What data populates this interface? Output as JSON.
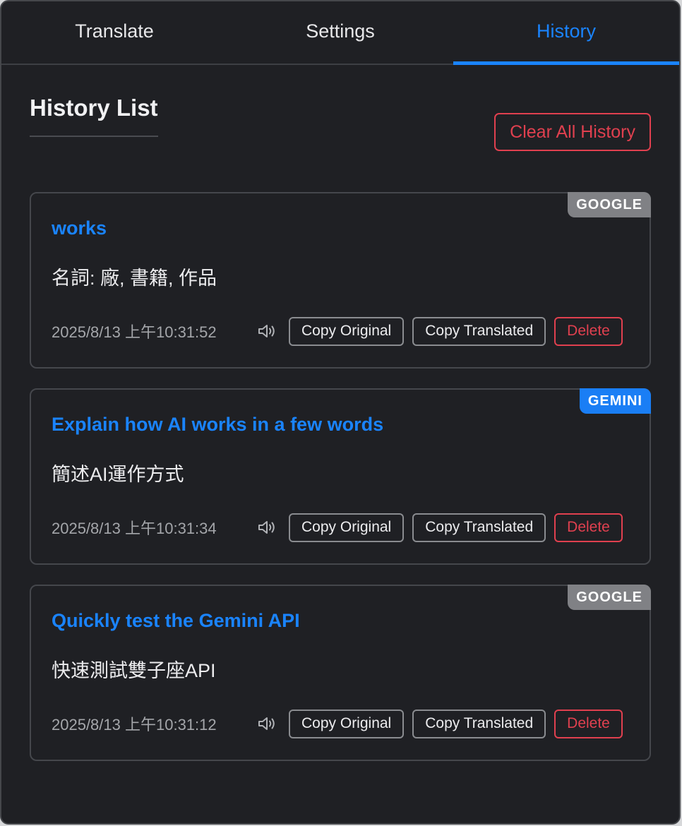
{
  "tabs": {
    "translate": "Translate",
    "settings": "Settings",
    "history": "History"
  },
  "history": {
    "title": "History List",
    "clear_all_label": "Clear All History",
    "items": [
      {
        "engine": "GOOGLE",
        "original": "works",
        "translated": "名詞: 廠, 書籍, 作品",
        "timestamp": "2025/8/13 上午10:31:52"
      },
      {
        "engine": "GEMINI",
        "original": "Explain how AI works in a few words",
        "translated": "簡述AI運作方式",
        "timestamp": "2025/8/13 上午10:31:34"
      },
      {
        "engine": "GOOGLE",
        "original": "Quickly test the Gemini API",
        "translated": "快速測試雙子座API",
        "timestamp": "2025/8/13 上午10:31:12"
      }
    ],
    "actions": {
      "copy_original": "Copy Original",
      "copy_translated": "Copy Translated",
      "delete": "Delete"
    }
  },
  "colors": {
    "accent": "#1a84ff",
    "danger": "#e0404f",
    "google_badge": "#808185",
    "gemini_badge": "#1a7ef5",
    "background": "#1f2024"
  },
  "active_tab": "history"
}
